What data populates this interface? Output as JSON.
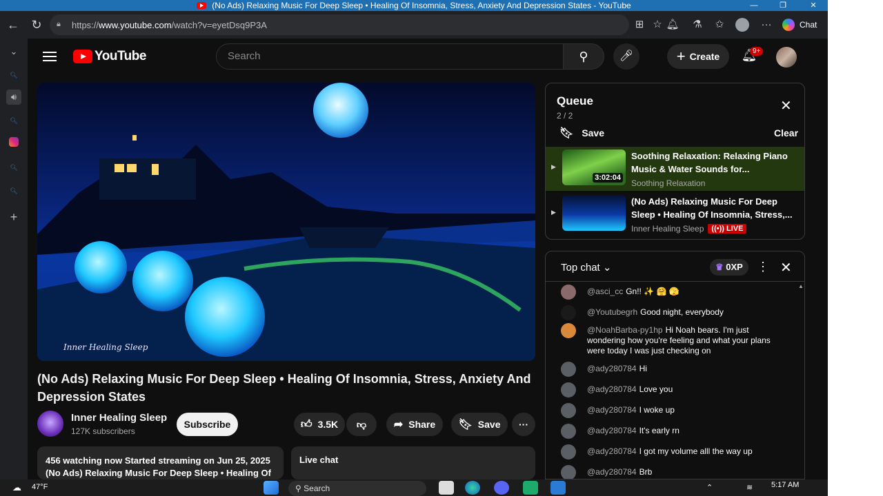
{
  "window": {
    "title": "(No Ads) Relaxing Music For Deep Sleep • Healing Of Insomnia, Stress, Anxiety And Depression States - YouTube"
  },
  "browser": {
    "url_prefix": "https://",
    "url_host": "www.youtube.com",
    "url_path": "/watch?v=eyetDsq9P3A",
    "chat_label": "Chat"
  },
  "youtube": {
    "logo_text": "YouTube",
    "search_placeholder": "Search",
    "create_label": "Create",
    "notification_count": "9+"
  },
  "video": {
    "title": "(No Ads) Relaxing Music For Deep Sleep • Healing Of Insomnia, Stress, Anxiety And Depression States",
    "watermark": "Inner Healing Sleep",
    "channel_name": "Inner Healing Sleep",
    "subscribers": "127K subscribers",
    "subscribe_label": "Subscribe",
    "likes": "3.5K",
    "share_label": "Share",
    "save_label": "Save",
    "description_line1": "456 watching now  Started streaming on Jun 25, 2025",
    "description_line2": "(No Ads) Relaxing Music For Deep Sleep • Healing Of",
    "live_chat_label": "Live chat"
  },
  "queue": {
    "title": "Queue",
    "count": "2 / 2",
    "save_label": "Save",
    "clear_label": "Clear",
    "items": [
      {
        "title": "Soothing Relaxation: Relaxing Piano Music & Water Sounds for...",
        "channel": "Soothing Relaxation",
        "duration": "3:02:04"
      },
      {
        "title": "(No Ads) Relaxing Music For Deep Sleep • Healing Of Insomnia, Stress,...",
        "channel": "Inner Healing Sleep",
        "badge": "LIVE"
      }
    ]
  },
  "chat": {
    "title": "Top chat",
    "xp": "0XP",
    "messages": [
      {
        "author": "@asci_cc",
        "text": "Gn!!"
      },
      {
        "author": "@Youtubegrh",
        "text": "Good night, everybody"
      },
      {
        "author": "@NoahBarba-py1hp",
        "text": "Hi Noah bears. I'm just wondering how you're feeling and what your plans were today I was just checking on"
      },
      {
        "author": "@ady280784",
        "text": "Hi"
      },
      {
        "author": "@ady280784",
        "text": "Love you"
      },
      {
        "author": "@ady280784",
        "text": "I woke up"
      },
      {
        "author": "@ady280784",
        "text": "It's early rn"
      },
      {
        "author": "@ady280784",
        "text": "I got my volume alll the way up"
      },
      {
        "author": "@ady280784",
        "text": "Brb"
      }
    ]
  },
  "taskbar": {
    "temperature": "47°F",
    "search_label": "Search",
    "time": "5:17 AM"
  }
}
